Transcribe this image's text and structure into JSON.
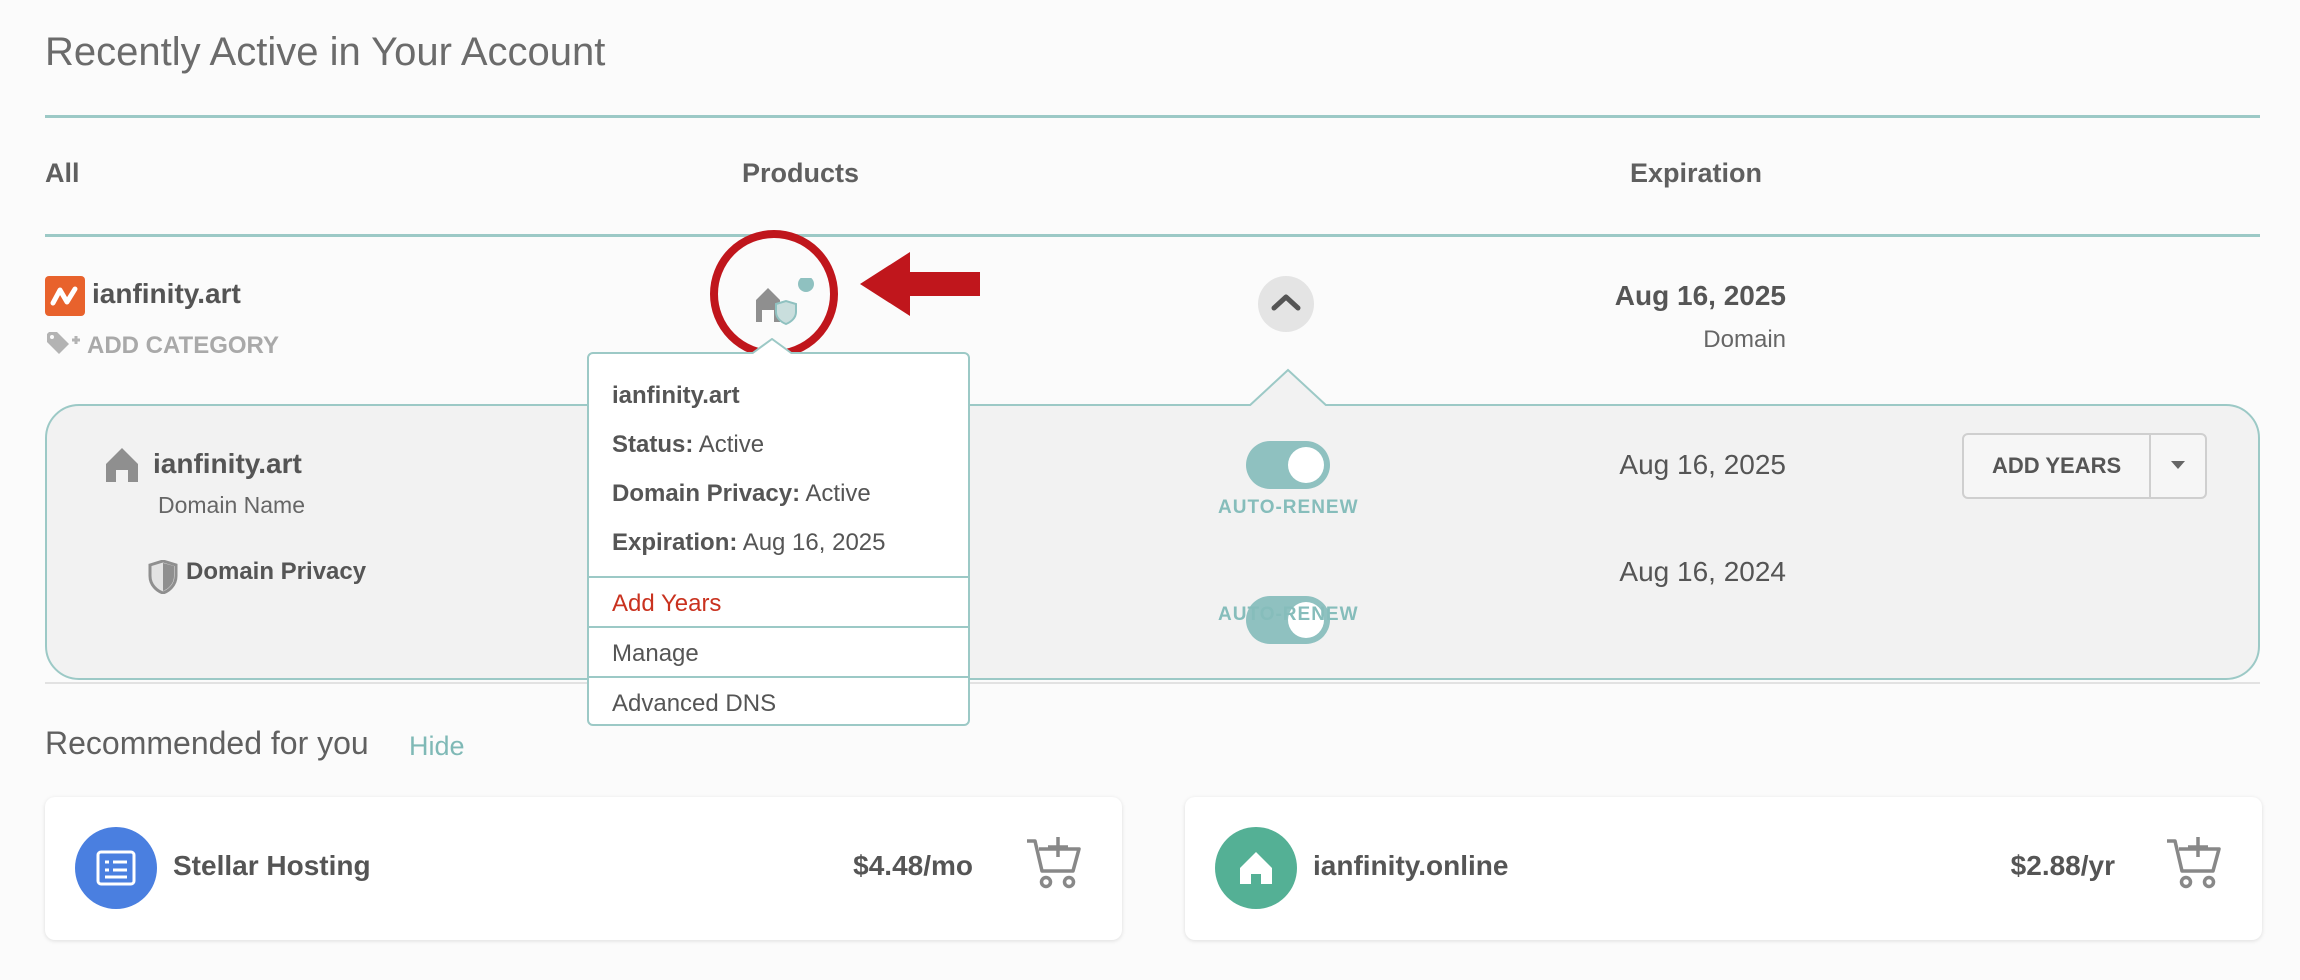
{
  "section_title": "Recently Active in Your Account",
  "columns": {
    "all": "All",
    "products": "Products",
    "expiration": "Expiration"
  },
  "domain": {
    "name": "ianfinity.art",
    "add_category": "ADD CATEGORY",
    "expiration": "Aug 16, 2025",
    "type": "Domain"
  },
  "details": {
    "domain_row": {
      "title": "ianfinity.art",
      "subtitle": "Domain Name",
      "toggle_label": "AUTO-RENEW",
      "date": "Aug 16, 2025"
    },
    "privacy_row": {
      "title": "Domain Privacy",
      "toggle_label": "AUTO-RENEW",
      "date": "Aug 16, 2024"
    },
    "add_years_label": "ADD YEARS"
  },
  "popover": {
    "title": "ianfinity.art",
    "status_label": "Status:",
    "status_value": "Active",
    "privacy_label": "Domain Privacy:",
    "privacy_value": "Active",
    "expiration_label": "Expiration:",
    "expiration_value": "Aug 16, 2025",
    "menu": [
      "Add Years",
      "Manage",
      "Advanced DNS"
    ]
  },
  "recommended": {
    "title": "Recommended for you",
    "hide_label": "Hide",
    "items": [
      {
        "name": "Stellar Hosting",
        "price": "$4.48/mo",
        "icon": "hosting-icon",
        "color": "#4a7fe0"
      },
      {
        "name": "ianfinity.online",
        "price": "$2.88/yr",
        "icon": "house-icon",
        "color": "#54b095"
      }
    ]
  },
  "colors": {
    "teal": "#9cc9c6",
    "red_annotation": "#c0161c",
    "accent_red": "#c9321f",
    "brand_orange": "#e8622c"
  }
}
